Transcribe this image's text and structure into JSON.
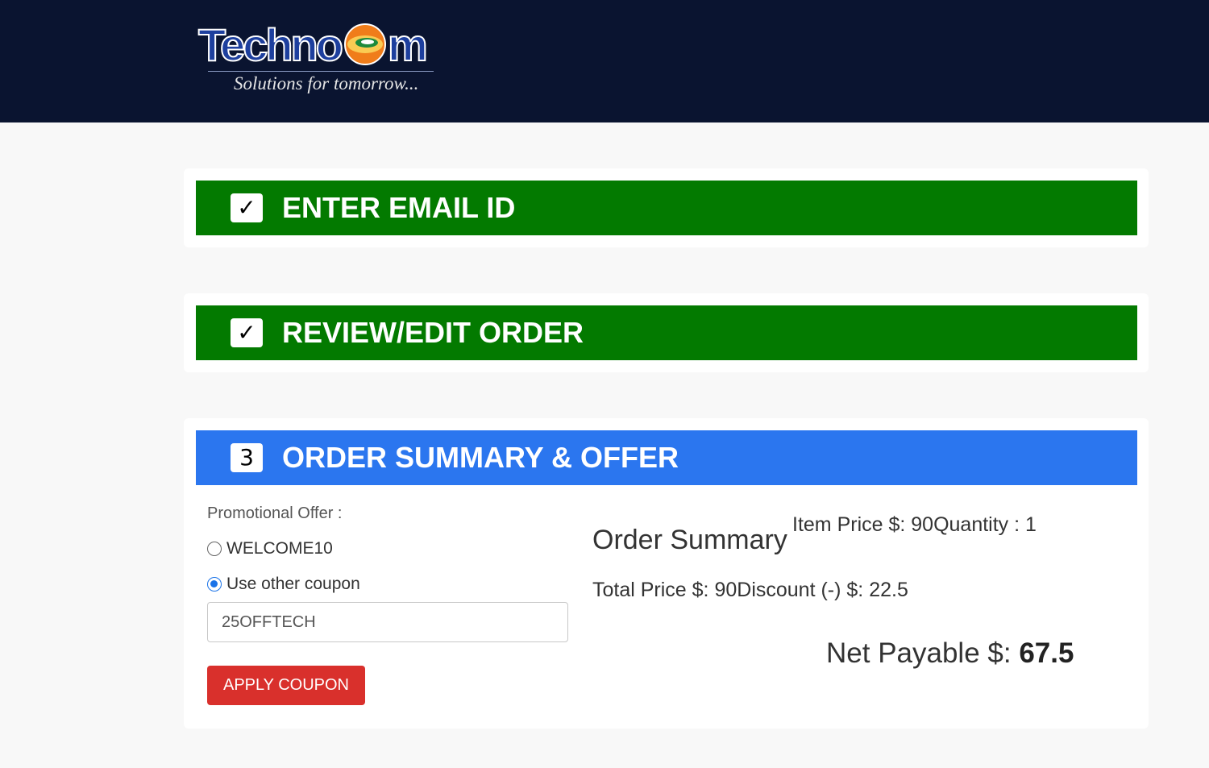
{
  "brand": {
    "name_part1": "Techno",
    "name_part2": "m",
    "tagline": "Solutions for tomorrow...",
    "colors": {
      "header_bg": "#0a1430",
      "wordmark": "#1d3f9e",
      "orb": "#f07d1a"
    }
  },
  "steps": [
    {
      "badge": "✓",
      "badge_icon": "checkmark-icon",
      "title": "ENTER EMAIL ID",
      "state": "done",
      "color": "#037a00"
    },
    {
      "badge": "✓",
      "badge_icon": "checkmark-icon",
      "title": "REVIEW/EDIT ORDER",
      "state": "done",
      "color": "#037a00"
    },
    {
      "badge": "3",
      "title": "ORDER SUMMARY & OFFER",
      "state": "active",
      "color": "#2b76ef"
    }
  ],
  "offer": {
    "label": "Promotional Offer :",
    "options": [
      {
        "label": "WELCOME10",
        "checked": false
      },
      {
        "label": "Use other coupon",
        "checked": true
      }
    ],
    "coupon_value": "25OFFTECH",
    "apply_label": "APPLY COUPON",
    "apply_color": "#d9302c"
  },
  "summary": {
    "title": "Order Summary",
    "item_price_label": "Item Price $: ",
    "item_price": "90",
    "quantity_label": "Quantity : ",
    "quantity": "1",
    "total_label": "Total Price $: ",
    "total": "90",
    "discount_label": "Discount (-) $: ",
    "discount": "22.5",
    "net_label": "Net Payable $: ",
    "net_value": "67.5"
  }
}
